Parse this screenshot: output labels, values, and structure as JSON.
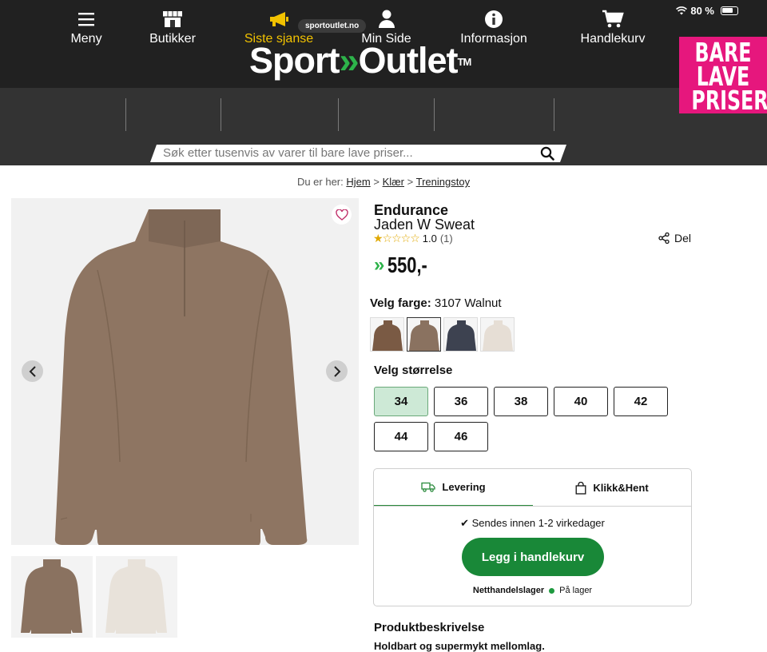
{
  "status_bar": {
    "battery": "80 %"
  },
  "header": {
    "url": "sportoutlet.no",
    "logo_part1": "Sport",
    "logo_arrows": "»",
    "logo_part2": "Outlet",
    "logo_tm": "TM",
    "promo": [
      "BARE",
      "LAVE",
      "PRISER"
    ],
    "brand_green": "#2db34a",
    "promo_pink": "#e6177d"
  },
  "nav": {
    "items": [
      {
        "label": "Meny",
        "icon": "menu-icon"
      },
      {
        "label": "Butikker",
        "icon": "store-icon"
      },
      {
        "label": "Siste sjanse",
        "icon": "megaphone-icon"
      },
      {
        "label": "Min Side",
        "icon": "user-icon"
      },
      {
        "label": "Informasjon",
        "icon": "info-icon"
      },
      {
        "label": "Handlekurv",
        "icon": "cart-icon"
      }
    ],
    "highlight_color": "#f2c200"
  },
  "search": {
    "placeholder": "Søk etter tusenvis av varer til bare lave priser..."
  },
  "breadcrumb": {
    "prefix": "Du er her:",
    "items": [
      "Hjem",
      "Klær",
      "Treningstoy"
    ],
    "separator": ">"
  },
  "product": {
    "brand": "Endurance",
    "name": "Jaden W Sweat",
    "rating": "1.0",
    "review_count": "(1)",
    "stars_filled": 1,
    "stars_total": 5,
    "share_label": "Del",
    "price_arrows": "»",
    "price": "550,-",
    "color_label": "Velg farge:",
    "color_value": "3107 Walnut",
    "swatches": [
      {
        "name": "dark-brown",
        "color": "#7a5a44"
      },
      {
        "name": "walnut",
        "color": "#8a7260"
      },
      {
        "name": "navy",
        "color": "#3d4250"
      },
      {
        "name": "cream",
        "color": "#e6ded5"
      }
    ],
    "size_label": "Velg størrelse",
    "sizes": [
      "34",
      "36",
      "38",
      "40",
      "42",
      "44",
      "46"
    ],
    "selected_size": "34"
  },
  "delivery": {
    "tab_delivery": "Levering",
    "tab_pickup": "Klikk&Hent",
    "ship_text": "Sendes innen 1-2 virkedager",
    "check": "✔",
    "add_to_cart": "Legg i handlekurv",
    "stock_location": "Netthandelslager",
    "stock_status": "På lager"
  },
  "description": {
    "title": "Produktbeskrivelse",
    "text": "Holdbart og supermykt mellomlag."
  }
}
